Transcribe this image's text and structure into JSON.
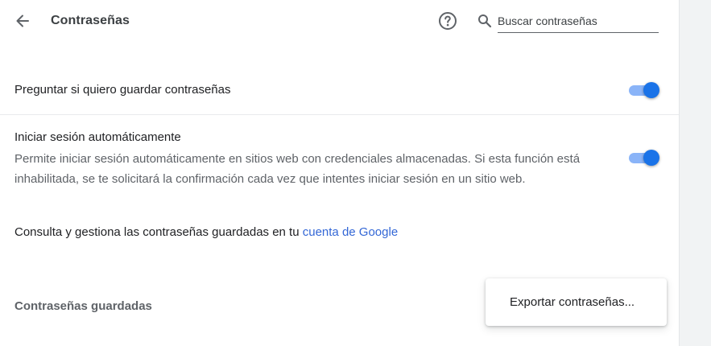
{
  "header": {
    "title": "Contraseñas",
    "search_placeholder": "Buscar contraseñas",
    "search_value": ""
  },
  "icons": {
    "back": "arrow-back-icon",
    "help": "help-circle-icon",
    "search": "search-icon"
  },
  "settings": {
    "offer_to_save": {
      "label": "Preguntar si quiero guardar contraseñas",
      "enabled": true
    },
    "auto_signin": {
      "label": "Iniciar sesión automáticamente",
      "description": "Permite iniciar sesión automáticamente en sitios web con credenciales almacenadas. Si esta función está inhabilitada, se te solicitará la confirmación cada vez que intentes iniciar sesión en un sitio web.",
      "enabled": true
    }
  },
  "account": {
    "text": "Consulta y gestiona las contraseñas guardadas en tu ",
    "link_text": "cuenta de Google"
  },
  "saved_passwords": {
    "title": "Contraseñas guardadas"
  },
  "menu": {
    "export_label": "Exportar contraseñas..."
  },
  "colors": {
    "accent": "#1a73e8",
    "toggle_track": "#8ab4f8",
    "link": "#3367d6",
    "background": "#f1f3f4"
  }
}
